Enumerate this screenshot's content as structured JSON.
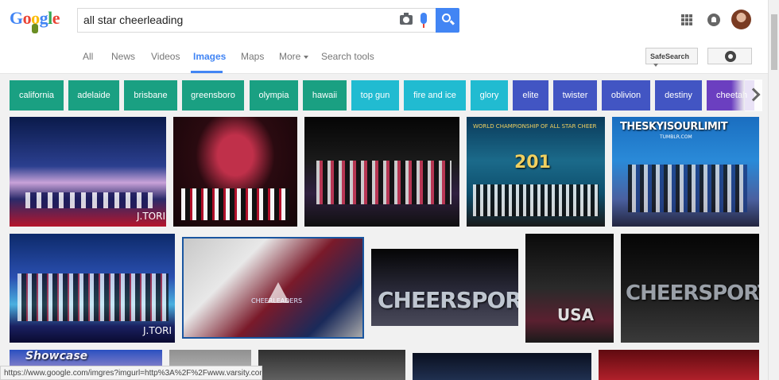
{
  "search": {
    "query": "all star cheerleading"
  },
  "logo": {
    "letters": [
      "G",
      "o",
      "o",
      "g",
      "l",
      "e"
    ]
  },
  "nav": {
    "tabs": [
      {
        "label": "All"
      },
      {
        "label": "News"
      },
      {
        "label": "Videos"
      },
      {
        "label": "Images"
      },
      {
        "label": "Maps"
      },
      {
        "label": "More"
      },
      {
        "label": "Search tools"
      }
    ],
    "active": "Images",
    "safesearch": "SafeSearch"
  },
  "chips": [
    {
      "label": "california",
      "color": "#1aa082"
    },
    {
      "label": "adelaide",
      "color": "#1aa082"
    },
    {
      "label": "brisbane",
      "color": "#1aa082"
    },
    {
      "label": "greensboro",
      "color": "#1aa082"
    },
    {
      "label": "olympia",
      "color": "#1aa082"
    },
    {
      "label": "hawaii",
      "color": "#1aa082"
    },
    {
      "label": "top gun",
      "color": "#21bbd1"
    },
    {
      "label": "fire and ice",
      "color": "#21bbd1"
    },
    {
      "label": "glory",
      "color": "#21bbd1"
    },
    {
      "label": "elite",
      "color": "#4255c3"
    },
    {
      "label": "twister",
      "color": "#4255c3"
    },
    {
      "label": "oblivion",
      "color": "#4255c3"
    },
    {
      "label": "destiny",
      "color": "#4255c3"
    },
    {
      "label": "cheetah",
      "color": "#6b3fc0"
    }
  ],
  "images": {
    "row1_texts": {
      "jtori": "J.TORI",
      "worlds": "WORLD CHAMPIONSHIP OF ALL STAR CHEER",
      "year": "201",
      "skyline": "THESKYISOURLIMIT",
      "tumblr": "TUMBLR.COM"
    },
    "row2_texts": {
      "jtori": "J.TORI",
      "cheersport1": "CHEERSPORT",
      "cheersport2": "CHEERSPORT",
      "usa": "USA",
      "leaders": "CHEERLEADERS"
    },
    "row3_texts": {
      "showcase": "Showcase"
    }
  },
  "status": {
    "url": "https://www.google.com/imgres?imgurl=http%3A%2F%2Fwww.varsity.com%..."
  }
}
